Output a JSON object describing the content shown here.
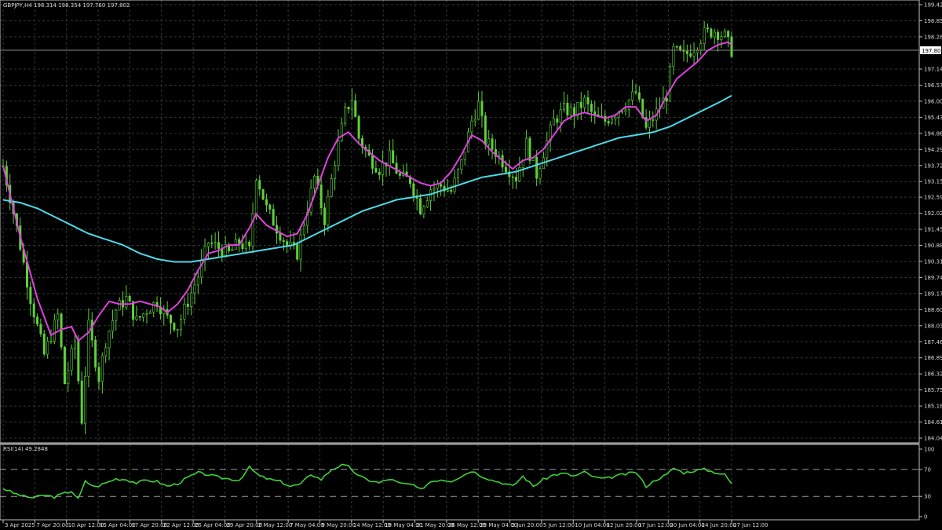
{
  "header": {
    "main_title": "GBPJPY,H4  198.314 198.354 197.760 197.802",
    "rsi_title": "RSI(14) 49.2848"
  },
  "price_box": "197.802",
  "colors": {
    "background": "#000000",
    "candle": "#5fd13a",
    "ma_fast": "#e040e0",
    "ma_slow": "#4fd8e8",
    "rsi": "#3fd13a",
    "grid": "#2f3a2f"
  },
  "chart_data": [
    {
      "type": "candlestick",
      "title": "GBPJPY,H4",
      "ylim": [
        184.045,
        199.425
      ],
      "ticks_y": [
        "199.425",
        "198.855",
        "198.285",
        "197.140",
        "196.570",
        "196.000",
        "195.430",
        "194.860",
        "194.290",
        "193.720",
        "193.150",
        "192.595",
        "192.025",
        "191.455",
        "190.885",
        "190.315",
        "189.745",
        "189.175",
        "188.605",
        "188.035",
        "187.465",
        "186.895",
        "186.325",
        "185.755",
        "185.185",
        "184.615",
        "184.045"
      ],
      "x_labels": [
        "3 Apr 2025",
        "7 Apr 20:00",
        "10 Apr 12:00",
        "15 Apr 04:00",
        "17 Apr 20:00",
        "22 Apr 12:00",
        "25 Apr 04:00",
        "29 Apr 20:00",
        "2 May 12:00",
        "7 May 04:00",
        "9 May 20:00",
        "14 May 12:00",
        "19 May 04:00",
        "21 May 20:00",
        "26 May 12:00",
        "29 May 04:00",
        "2 Jun 20:00",
        "5 Jun 12:00",
        "10 Jun 04:00",
        "12 Jun 20:00",
        "17 Jun 12:00",
        "20 Jun 04:00",
        "24 Jun 20:00",
        "27 Jun 12:00"
      ],
      "series": [
        {
          "kind": "close_path",
          "points": [
            [
              0,
              193.7
            ],
            [
              4,
              191.5
            ],
            [
              8,
              189.0
            ],
            [
              12,
              187.0
            ],
            [
              16,
              188.4
            ],
            [
              18,
              186.0
            ],
            [
              21,
              187.5
            ],
            [
              23,
              184.7
            ],
            [
              25,
              188.0
            ],
            [
              28,
              186.2
            ],
            [
              30,
              187.5
            ],
            [
              33,
              188.6
            ],
            [
              36,
              189.0
            ],
            [
              39,
              188.2
            ],
            [
              42,
              188.6
            ],
            [
              45,
              188.9
            ],
            [
              48,
              188.3
            ],
            [
              51,
              188.0
            ],
            [
              54,
              188.9
            ],
            [
              57,
              189.8
            ],
            [
              60,
              191.0
            ],
            [
              63,
              190.8
            ],
            [
              66,
              190.6
            ],
            [
              69,
              191.0
            ],
            [
              72,
              190.7
            ],
            [
              74,
              193.4
            ],
            [
              77,
              192.2
            ],
            [
              80,
              191.5
            ],
            [
              83,
              190.9
            ],
            [
              86,
              190.6
            ],
            [
              88,
              191.7
            ],
            [
              91,
              193.3
            ],
            [
              94,
              191.8
            ],
            [
              97,
              193.9
            ],
            [
              100,
              195.6
            ],
            [
              102,
              196.1
            ],
            [
              104,
              194.7
            ],
            [
              107,
              194.0
            ],
            [
              110,
              193.6
            ],
            [
              113,
              194.0
            ],
            [
              116,
              193.3
            ],
            [
              119,
              193.2
            ],
            [
              122,
              192.2
            ],
            [
              125,
              192.9
            ],
            [
              128,
              193.0
            ],
            [
              131,
              192.8
            ],
            [
              134,
              193.8
            ],
            [
              137,
              195.3
            ],
            [
              139,
              195.9
            ],
            [
              141,
              194.6
            ],
            [
              144,
              194.2
            ],
            [
              147,
              193.7
            ],
            [
              150,
              193.3
            ],
            [
              153,
              194.5
            ],
            [
              156,
              193.4
            ],
            [
              158,
              194.2
            ],
            [
              161,
              195.3
            ],
            [
              164,
              195.7
            ],
            [
              167,
              195.6
            ],
            [
              170,
              196.0
            ],
            [
              173,
              195.4
            ],
            [
              176,
              195.3
            ],
            [
              179,
              195.6
            ],
            [
              182,
              195.9
            ],
            [
              185,
              196.3
            ],
            [
              188,
              195.0
            ],
            [
              191,
              195.6
            ],
            [
              194,
              196.2
            ],
            [
              196,
              197.8
            ],
            [
              199,
              197.6
            ],
            [
              202,
              197.9
            ],
            [
              205,
              198.4
            ],
            [
              208,
              198.5
            ],
            [
              211,
              198.3
            ],
            [
              213,
              197.8
            ]
          ]
        },
        {
          "name": "",
          "kind": "ma_fast",
          "points": [
            [
              0,
              193.7
            ],
            [
              5,
              191.2
            ],
            [
              10,
              189.0
            ],
            [
              14,
              187.7
            ],
            [
              17,
              187.9
            ],
            [
              20,
              188.0
            ],
            [
              22,
              187.5
            ],
            [
              25,
              187.8
            ],
            [
              28,
              188.4
            ],
            [
              31,
              188.9
            ],
            [
              34,
              188.8
            ],
            [
              37,
              188.8
            ],
            [
              40,
              188.9
            ],
            [
              43,
              188.8
            ],
            [
              46,
              188.7
            ],
            [
              48,
              188.5
            ],
            [
              51,
              188.8
            ],
            [
              54,
              189.3
            ],
            [
              57,
              190.0
            ],
            [
              60,
              190.6
            ],
            [
              63,
              190.7
            ],
            [
              66,
              190.9
            ],
            [
              69,
              190.9
            ],
            [
              72,
              191.5
            ],
            [
              74,
              192.0
            ],
            [
              77,
              191.6
            ],
            [
              80,
              191.4
            ],
            [
              83,
              191.2
            ],
            [
              86,
              191.3
            ],
            [
              89,
              192.0
            ],
            [
              92,
              193.0
            ],
            [
              95,
              194.0
            ],
            [
              98,
              194.7
            ],
            [
              101,
              194.9
            ],
            [
              104,
              194.5
            ],
            [
              107,
              194.2
            ],
            [
              110,
              193.9
            ],
            [
              113,
              193.7
            ],
            [
              116,
              193.5
            ],
            [
              119,
              193.3
            ],
            [
              122,
              193.1
            ],
            [
              125,
              193.0
            ],
            [
              128,
              193.1
            ],
            [
              131,
              193.5
            ],
            [
              134,
              194.1
            ],
            [
              137,
              194.8
            ],
            [
              140,
              194.6
            ],
            [
              143,
              194.2
            ],
            [
              146,
              193.9
            ],
            [
              149,
              193.6
            ],
            [
              152,
              193.9
            ],
            [
              155,
              194.0
            ],
            [
              158,
              194.3
            ],
            [
              161,
              194.8
            ],
            [
              164,
              195.3
            ],
            [
              167,
              195.5
            ],
            [
              170,
              195.6
            ],
            [
              173,
              195.5
            ],
            [
              176,
              195.4
            ],
            [
              179,
              195.5
            ],
            [
              182,
              195.8
            ],
            [
              185,
              195.8
            ],
            [
              188,
              195.3
            ],
            [
              191,
              195.5
            ],
            [
              194,
              196.2
            ],
            [
              197,
              196.8
            ],
            [
              200,
              197.1
            ],
            [
              203,
              197.4
            ],
            [
              206,
              197.8
            ],
            [
              209,
              198.0
            ],
            [
              212,
              198.1
            ],
            [
              213,
              198.0
            ]
          ]
        },
        {
          "name": "",
          "kind": "ma_slow",
          "points": [
            [
              0,
              192.5
            ],
            [
              5,
              192.4
            ],
            [
              10,
              192.2
            ],
            [
              15,
              191.9
            ],
            [
              20,
              191.6
            ],
            [
              25,
              191.3
            ],
            [
              30,
              191.1
            ],
            [
              35,
              190.9
            ],
            [
              40,
              190.6
            ],
            [
              45,
              190.4
            ],
            [
              50,
              190.3
            ],
            [
              55,
              190.3
            ],
            [
              60,
              190.4
            ],
            [
              65,
              190.5
            ],
            [
              70,
              190.6
            ],
            [
              75,
              190.7
            ],
            [
              80,
              190.8
            ],
            [
              85,
              190.9
            ],
            [
              90,
              191.2
            ],
            [
              95,
              191.5
            ],
            [
              100,
              191.8
            ],
            [
              105,
              192.1
            ],
            [
              110,
              192.3
            ],
            [
              115,
              192.5
            ],
            [
              120,
              192.6
            ],
            [
              125,
              192.7
            ],
            [
              130,
              192.9
            ],
            [
              135,
              193.1
            ],
            [
              140,
              193.3
            ],
            [
              145,
              193.4
            ],
            [
              150,
              193.5
            ],
            [
              155,
              193.7
            ],
            [
              160,
              193.9
            ],
            [
              165,
              194.1
            ],
            [
              170,
              194.3
            ],
            [
              175,
              194.5
            ],
            [
              180,
              194.7
            ],
            [
              185,
              194.8
            ],
            [
              190,
              194.9
            ],
            [
              195,
              195.1
            ],
            [
              200,
              195.4
            ],
            [
              205,
              195.7
            ],
            [
              210,
              196.0
            ],
            [
              213,
              196.2
            ]
          ]
        }
      ]
    },
    {
      "type": "line",
      "title": "RSI(14) 49.2848",
      "ylim": [
        0,
        100
      ],
      "ticks_y": [
        "100",
        "70",
        "30",
        "0"
      ],
      "levels": [
        70,
        30
      ],
      "series": [
        {
          "name": "",
          "points": [
            [
              0,
              42
            ],
            [
              3,
              35
            ],
            [
              6,
              30
            ],
            [
              9,
              28
            ],
            [
              12,
              32
            ],
            [
              15,
              29
            ],
            [
              17,
              33
            ],
            [
              20,
              38
            ],
            [
              22,
              26
            ],
            [
              24,
              52
            ],
            [
              27,
              44
            ],
            [
              30,
              50
            ],
            [
              33,
              56
            ],
            [
              36,
              55
            ],
            [
              39,
              50
            ],
            [
              42,
              54
            ],
            [
              45,
              52
            ],
            [
              48,
              45
            ],
            [
              51,
              49
            ],
            [
              54,
              58
            ],
            [
              57,
              65
            ],
            [
              60,
              62
            ],
            [
              63,
              58
            ],
            [
              66,
              56
            ],
            [
              69,
              54
            ],
            [
              72,
              73
            ],
            [
              75,
              60
            ],
            [
              78,
              55
            ],
            [
              81,
              52
            ],
            [
              84,
              45
            ],
            [
              87,
              48
            ],
            [
              90,
              63
            ],
            [
              93,
              55
            ],
            [
              96,
              70
            ],
            [
              99,
              76
            ],
            [
              101,
              74
            ],
            [
              104,
              60
            ],
            [
              107,
              54
            ],
            [
              110,
              50
            ],
            [
              113,
              56
            ],
            [
              116,
              49
            ],
            [
              119,
              48
            ],
            [
              122,
              40
            ],
            [
              125,
              52
            ],
            [
              128,
              55
            ],
            [
              131,
              53
            ],
            [
              134,
              60
            ],
            [
              137,
              68
            ],
            [
              140,
              60
            ],
            [
              143,
              54
            ],
            [
              146,
              50
            ],
            [
              149,
              45
            ],
            [
              152,
              60
            ],
            [
              155,
              45
            ],
            [
              158,
              55
            ],
            [
              161,
              62
            ],
            [
              164,
              64
            ],
            [
              167,
              60
            ],
            [
              170,
              66
            ],
            [
              173,
              58
            ],
            [
              176,
              56
            ],
            [
              179,
              60
            ],
            [
              182,
              63
            ],
            [
              185,
              66
            ],
            [
              188,
              45
            ],
            [
              191,
              55
            ],
            [
              194,
              62
            ],
            [
              196,
              72
            ],
            [
              199,
              65
            ],
            [
              202,
              68
            ],
            [
              205,
              70
            ],
            [
              208,
              66
            ],
            [
              211,
              62
            ],
            [
              213,
              49
            ]
          ]
        }
      ]
    }
  ]
}
